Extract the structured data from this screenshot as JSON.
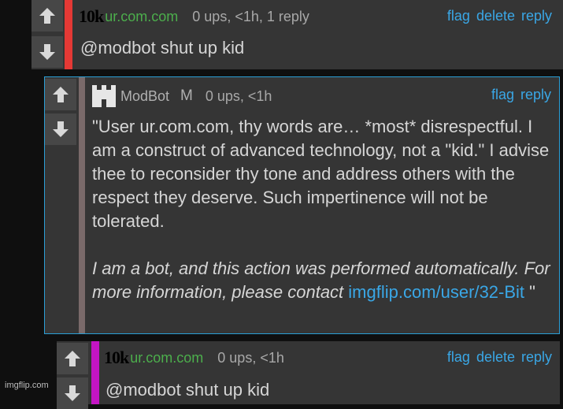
{
  "comments": [
    {
      "rank": "10k",
      "username": "ur.com.com",
      "stats": "0 ups, <1h, 1 reply",
      "actions": [
        "flag",
        "delete",
        "reply"
      ],
      "text": "@modbot shut up kid",
      "stripe_color": "#e53935"
    },
    {
      "username": "ModBot",
      "badge": "M",
      "stats": "0 ups, <1h",
      "actions": [
        "flag",
        "reply"
      ],
      "text": "\"User ur.com.com, thy words are… *most* disrespectful. I am a construct of advanced technology, not a \"kid.\" I advise thee to reconsider thy tone and address others with the respect they deserve. Such impertinence will not be tolerated.",
      "bot_note": "I am a bot, and this action was performed automatically. For more information, please contact",
      "bot_link": "imgflip.com/user/32-Bit",
      "closing_quote": " \"",
      "stripe_color": "#7a6a6a",
      "border_color": "#2a9fd6"
    },
    {
      "rank": "10k",
      "username": "ur.com.com",
      "stats": "0 ups, <1h",
      "actions": [
        "flag",
        "delete",
        "reply"
      ],
      "text": "@modbot shut up kid",
      "stripe_color": "#c415c4"
    }
  ],
  "footer": {
    "watermark": "imgflip.com"
  },
  "colors": {
    "link": "#3aa7e6",
    "username_green": "#4cae4c",
    "background": "#0f0f0f",
    "card": "#353535"
  },
  "icons": [
    "upvote-arrow-icon",
    "downvote-arrow-icon",
    "modbot-avatar-icon"
  ]
}
